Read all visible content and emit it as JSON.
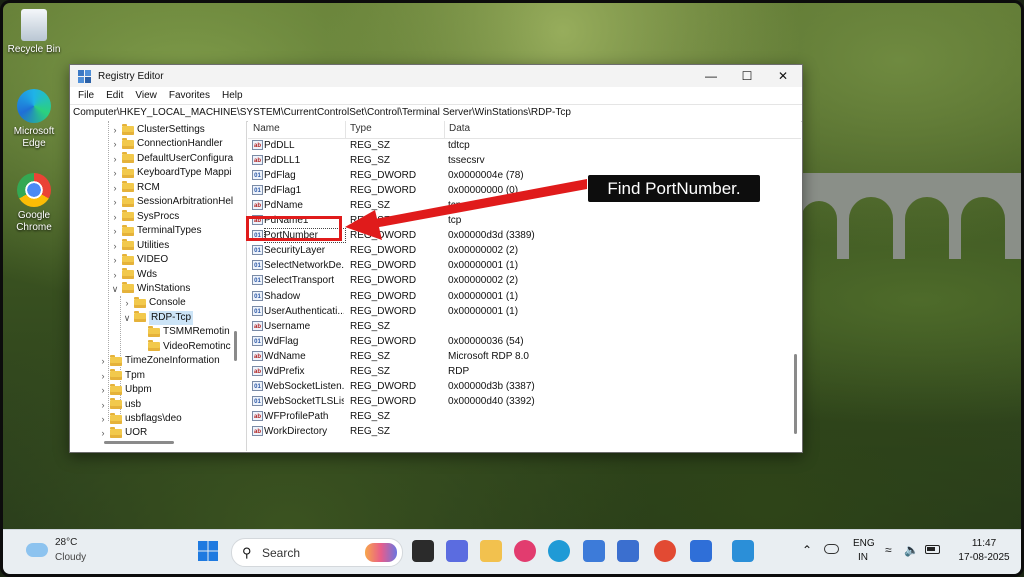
{
  "desktop": {
    "icons": [
      {
        "label": "Recycle Bin",
        "icon": "recycle-bin-icon"
      },
      {
        "label": "Microsoft Edge",
        "icon": "edge-icon"
      },
      {
        "label": "Google Chrome",
        "icon": "chrome-icon"
      }
    ]
  },
  "window": {
    "title": "Registry Editor",
    "controls": {
      "minimize": "—",
      "maximize": "☐",
      "close": "✕"
    },
    "menu": [
      "File",
      "Edit",
      "View",
      "Favorites",
      "Help"
    ],
    "address": "Computer\\HKEY_LOCAL_MACHINE\\SYSTEM\\CurrentControlSet\\Control\\Terminal Server\\WinStations\\RDP-Tcp"
  },
  "tree": {
    "nodes": [
      {
        "label": "ClusterSettings",
        "expanded": false
      },
      {
        "label": "ConnectionHandler",
        "expanded": false
      },
      {
        "label": "DefaultUserConfigura",
        "expanded": false
      },
      {
        "label": "KeyboardType Mappi",
        "expanded": false
      },
      {
        "label": "RCM",
        "expanded": false
      },
      {
        "label": "SessionArbitrationHel",
        "expanded": false
      },
      {
        "label": "SysProcs",
        "expanded": false
      },
      {
        "label": "TerminalTypes",
        "expanded": false
      },
      {
        "label": "Utilities",
        "expanded": false
      },
      {
        "label": "VIDEO",
        "expanded": false
      },
      {
        "label": "Wds",
        "expanded": false
      },
      {
        "label": "WinStations",
        "expanded": true
      },
      {
        "label": "Console",
        "expanded": false
      },
      {
        "label": "RDP-Tcp",
        "expanded": true,
        "selected": true
      },
      {
        "label": "TSMMRemotin",
        "expanded": false
      },
      {
        "label": "VideoRemotinc",
        "expanded": false
      },
      {
        "label": "TimeZoneInformation",
        "expanded": false
      },
      {
        "label": "Tpm",
        "expanded": false
      },
      {
        "label": "Ubpm",
        "expanded": false
      },
      {
        "label": "usb",
        "expanded": false
      },
      {
        "label": "usbflags\\deo",
        "expanded": false
      },
      {
        "label": "UOR",
        "expanded": false
      }
    ]
  },
  "list": {
    "columns": [
      "Name",
      "Type",
      "Data"
    ],
    "rows": [
      {
        "name": "PdDLL",
        "type": "REG_SZ",
        "data": "tdtcp",
        "kind": "sz"
      },
      {
        "name": "PdDLL1",
        "type": "REG_SZ",
        "data": "tssecsrv",
        "kind": "sz"
      },
      {
        "name": "PdFlag",
        "type": "REG_DWORD",
        "data": "0x0000004e (78)",
        "kind": "dword"
      },
      {
        "name": "PdFlag1",
        "type": "REG_DWORD",
        "data": "0x00000000 (0)",
        "kind": "dword"
      },
      {
        "name": "PdName",
        "type": "REG_SZ",
        "data": "tcp",
        "kind": "sz"
      },
      {
        "name": "PdName1",
        "type": "REG_SZ",
        "data": "tcp",
        "kind": "sz"
      },
      {
        "name": "PortNumber",
        "type": "REG_DWORD",
        "data": "0x00000d3d (3389)",
        "kind": "dword"
      },
      {
        "name": "SecurityLayer",
        "type": "REG_DWORD",
        "data": "0x00000002 (2)",
        "kind": "dword"
      },
      {
        "name": "SelectNetworkDe...",
        "type": "REG_DWORD",
        "data": "0x00000001 (1)",
        "kind": "dword"
      },
      {
        "name": "SelectTransport",
        "type": "REG_DWORD",
        "data": "0x00000002 (2)",
        "kind": "dword"
      },
      {
        "name": "Shadow",
        "type": "REG_DWORD",
        "data": "0x00000001 (1)",
        "kind": "dword"
      },
      {
        "name": "UserAuthenticati...",
        "type": "REG_DWORD",
        "data": "0x00000001 (1)",
        "kind": "dword"
      },
      {
        "name": "Username",
        "type": "REG_SZ",
        "data": "",
        "kind": "sz"
      },
      {
        "name": "WdFlag",
        "type": "REG_DWORD",
        "data": "0x00000036 (54)",
        "kind": "dword"
      },
      {
        "name": "WdName",
        "type": "REG_SZ",
        "data": "Microsoft RDP 8.0",
        "kind": "sz"
      },
      {
        "name": "WdPrefix",
        "type": "REG_SZ",
        "data": "RDP",
        "kind": "sz"
      },
      {
        "name": "WebSocketListen...",
        "type": "REG_DWORD",
        "data": "0x00000d3b (3387)",
        "kind": "dword"
      },
      {
        "name": "WebSocketTLSLis...",
        "type": "REG_DWORD",
        "data": "0x00000d40 (3392)",
        "kind": "dword"
      },
      {
        "name": "WFProfilePath",
        "type": "REG_SZ",
        "data": "",
        "kind": "sz"
      },
      {
        "name": "WorkDirectory",
        "type": "REG_SZ",
        "data": "",
        "kind": "sz"
      }
    ]
  },
  "annotation": {
    "callout": "Find PortNumber.",
    "color": "#e01b1b"
  },
  "taskbar": {
    "weather": {
      "temp": "28°C",
      "condition": "Cloudy"
    },
    "search_label": "Search",
    "apps": [
      "task-view-icon",
      "copilot-icon",
      "file-explorer-icon",
      "slack-icon",
      "edge-icon",
      "store-icon",
      "notepad-icon",
      "chrome-icon",
      "settings-icon",
      "photos-icon"
    ],
    "tray": {
      "lang_line1": "ENG",
      "lang_line2": "IN",
      "time": "11:47",
      "date": "17-08-2025"
    }
  }
}
